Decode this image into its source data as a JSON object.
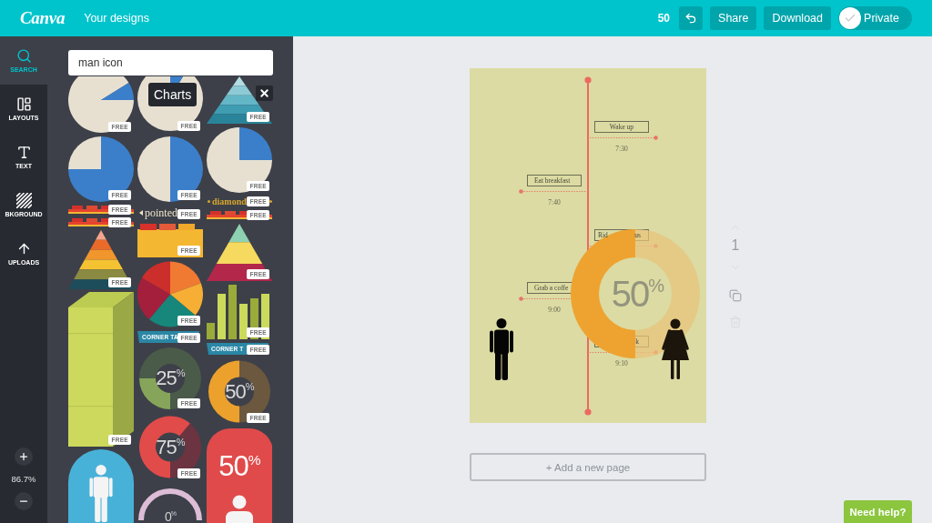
{
  "topbar": {
    "logo": "Canva",
    "nav_link": "Your designs",
    "count": "50",
    "buttons": [
      {
        "kind": "undo"
      },
      {
        "kind": "share",
        "label": "Share"
      },
      {
        "kind": "download",
        "label": "Download"
      }
    ],
    "privacy": {
      "label": "Private",
      "on": true
    }
  },
  "rail": {
    "items": [
      {
        "kind": "search",
        "label": "SEARCH",
        "selected": true
      },
      {
        "kind": "layouts",
        "label": "LAYOUTS",
        "selected": false
      },
      {
        "kind": "text",
        "label": "TEXT",
        "selected": false
      },
      {
        "kind": "background",
        "label": "BKGROUND",
        "selected": false
      },
      {
        "kind": "uploads",
        "label": "UPLOADS",
        "selected": false
      }
    ],
    "zoom": "86.7%"
  },
  "panel": {
    "search": {
      "value": "man icon"
    },
    "tooltip": "Charts",
    "columns": [
      [
        {
          "kind": "wedgepie",
          "badge": "FREE"
        },
        {
          "kind": "majoritypie",
          "badge": "FREE"
        },
        {
          "kind": "tabstrip",
          "badge": "FREE"
        },
        {
          "kind": "tabstrip",
          "badge": "FREE"
        },
        {
          "kind": "layeredpyramid",
          "badge": "FREE"
        },
        {
          "kind": "cuboid",
          "badge": "FREE"
        },
        {
          "kind": "personarch"
        }
      ],
      [
        {
          "kind": "sliverpie",
          "badge": "FREE"
        },
        {
          "kind": "halfpie",
          "badge": "FREE"
        },
        {
          "kind": "arrowtext",
          "text": "pointed",
          "badge": "FREE"
        },
        {
          "kind": "foldertabs",
          "badge": "FREE"
        },
        {
          "kind": "colorpie",
          "badge": "FREE"
        },
        {
          "kind": "cornerbanner",
          "text": "CORNER TA",
          "badge": "FREE"
        },
        {
          "kind": "greendonut",
          "text": "25$^{%}$",
          "badge": "FREE"
        },
        {
          "kind": "reddonut",
          "text": "75$^{%}$",
          "badge": "FREE"
        },
        {
          "kind": "pinkring",
          "text": "0$^{%}$"
        }
      ],
      [
        {
          "kind": "tealpyramid",
          "badge": "FREE"
        },
        {
          "kind": "quarterpie",
          "badge": "FREE"
        },
        {
          "kind": "dottedtext",
          "text": "diamond",
          "badge": "FREE"
        },
        {
          "kind": "tabstrip",
          "badge": "FREE"
        },
        {
          "kind": "tieredpyramid",
          "badge": "FREE"
        },
        {
          "kind": "barchart",
          "badge": "FREE"
        },
        {
          "kind": "cornerbanner",
          "text": "CORNER T",
          "badge": "FREE"
        },
        {
          "kind": "orangedonut",
          "text": "50$^{%}$",
          "badge": "FREE"
        },
        {
          "kind": "redarch",
          "text": "50$^{%}$"
        }
      ]
    ]
  },
  "workspace": {
    "design": {
      "events": [
        {
          "label": "Wake up",
          "time": "7:30"
        },
        {
          "label": "Eat breakfast",
          "time": "7:40"
        },
        {
          "label": "Rid",
          "label_end": "us"
        },
        {
          "label": "Grab a coffe",
          "time": "9:00"
        },
        {
          "label_end": "k",
          "time": "9:10"
        }
      ],
      "donut": "50$^{%}$",
      "figures": [
        {
          "kind": "man"
        },
        {
          "kind": "woman"
        }
      ]
    },
    "add_page": "+ Add a new page",
    "page_controls": [
      {
        "kind": "up",
        "disabled": true
      },
      {
        "kind": "number",
        "label": "1"
      },
      {
        "kind": "down",
        "disabled": true
      },
      {
        "kind": "copy",
        "disabled": false
      },
      {
        "kind": "delete",
        "disabled": true
      }
    ],
    "help": "Need help?"
  }
}
